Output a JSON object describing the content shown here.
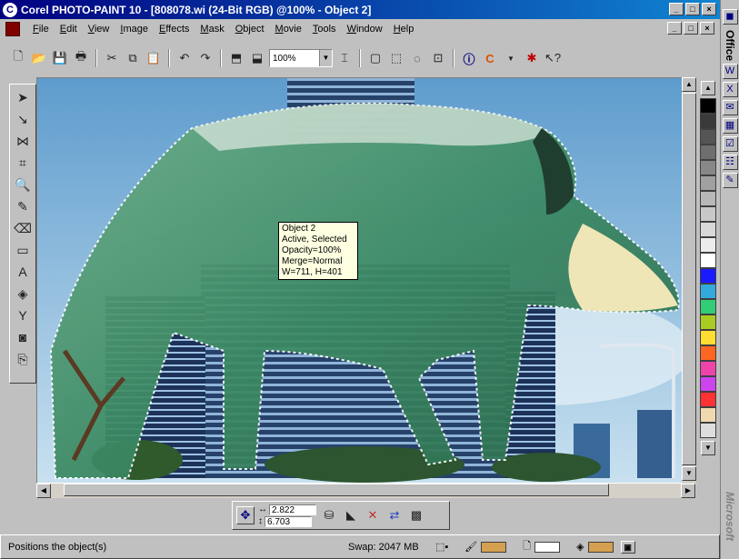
{
  "window": {
    "title": "Corel PHOTO-PAINT 10 - [808078.wi (24-Bit RGB) @100% - Object 2]"
  },
  "menu": [
    "File",
    "Edit",
    "View",
    "Image",
    "Effects",
    "Mask",
    "Object",
    "Movie",
    "Tools",
    "Window",
    "Help"
  ],
  "toolbar": {
    "zoom": "100%"
  },
  "tooltip": {
    "lines": [
      "Object 2",
      "Active, Selected",
      "Opacity=100%",
      "Merge=Normal",
      "W=711, H=401"
    ]
  },
  "propbar": {
    "x_value": "2.822",
    "y_value": "6.703"
  },
  "status": {
    "message": "Positions the object(s)",
    "swap": "Swap: 2047 MB"
  },
  "officebar": {
    "label_top": "Office",
    "label_bottom": "Microsoft"
  },
  "palette": [
    "#000000",
    "#3a3a3a",
    "#555555",
    "#6e6e6e",
    "#888888",
    "#a0a0a0",
    "#b8b8b8",
    "#c8c8c8",
    "#d8d8d8",
    "#ececec",
    "#ffffff",
    "#1a1aff",
    "#33aadd",
    "#33cc77",
    "#aacc22",
    "#ffdd33",
    "#ff6622",
    "#ee44aa",
    "#cc44ee",
    "#ff3333",
    "#f0d8b0",
    "#dddddd"
  ],
  "colors": {
    "title_start": "#000080",
    "title_end": "#1084d0",
    "status_fill": "#d4a050"
  }
}
